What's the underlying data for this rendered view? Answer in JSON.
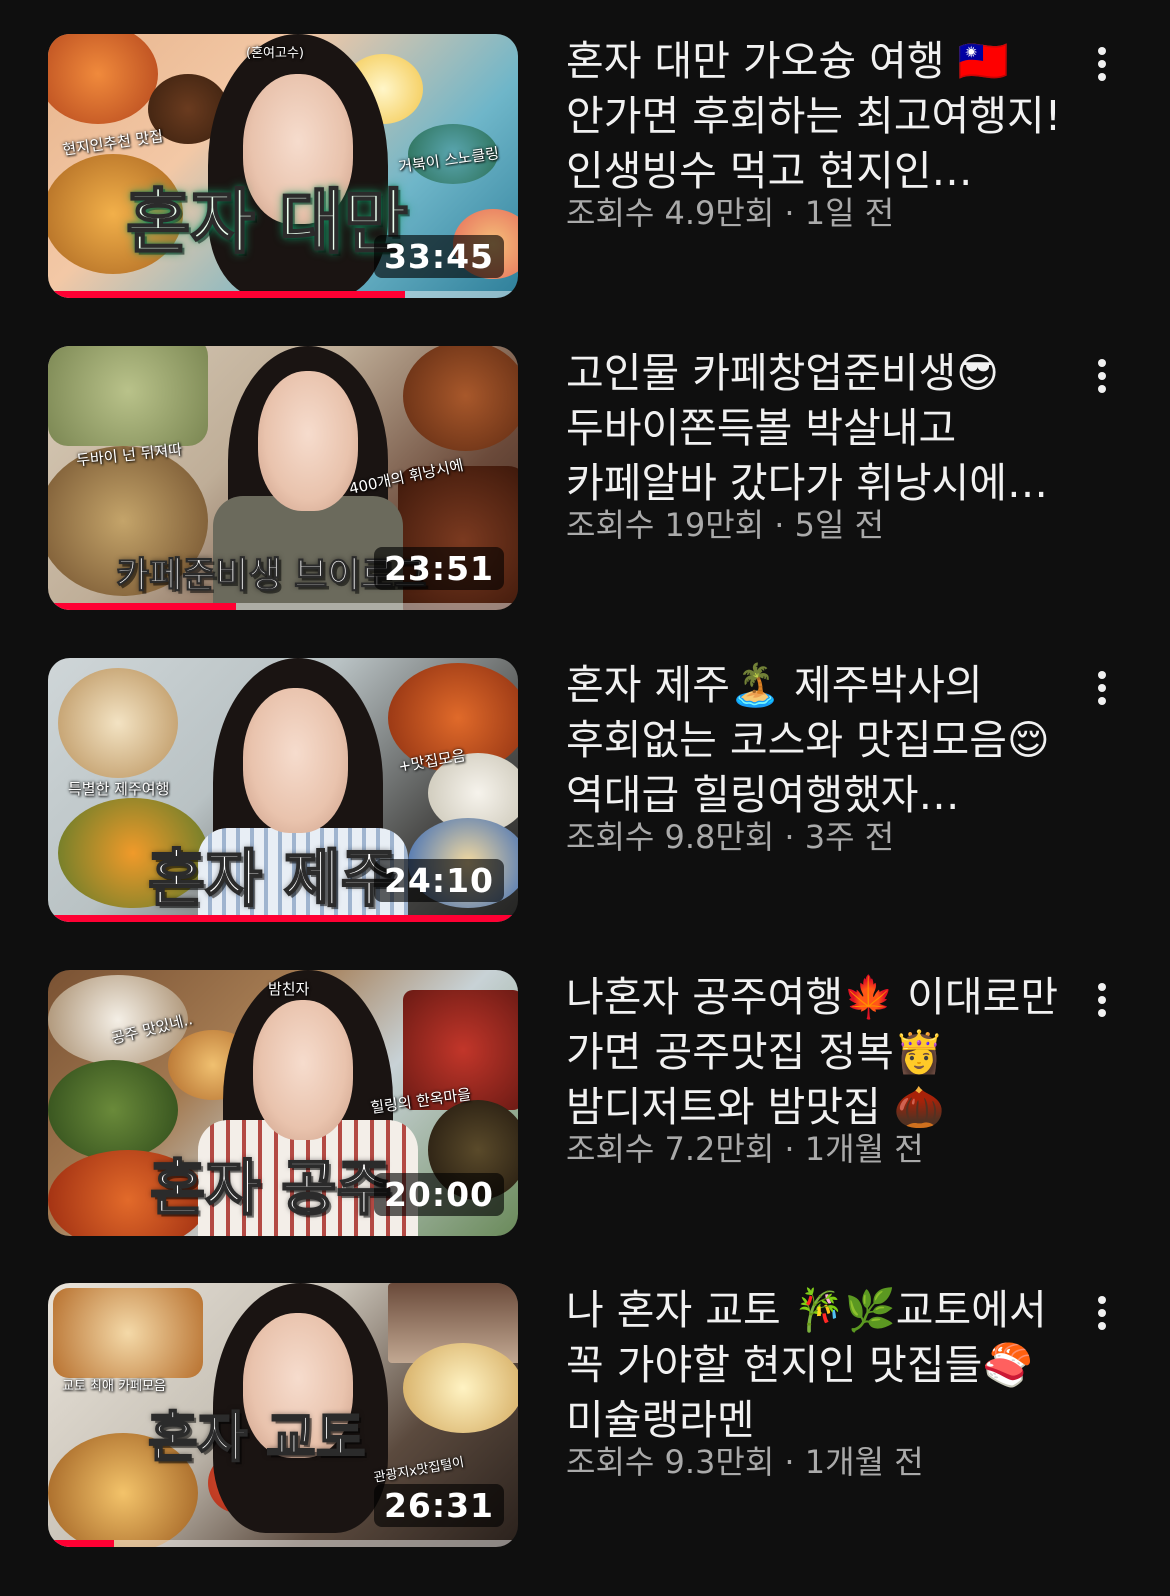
{
  "theme": {
    "background": "#0f0f0f",
    "title_color": "#f1f1f1",
    "meta_color": "#aaaaaa",
    "progress_color": "#ff0033"
  },
  "videos": [
    {
      "title": "혼자 대만 가오슝 여행 🇹🇼 안가면 후회하는 최고여행지! 인생빙수 먹고 현지인…",
      "views": "조회수 4.9만회",
      "age": "1일 전",
      "meta": "조회수 4.9만회 · 1일 전",
      "duration": "33:45",
      "watched_fraction": 0.76,
      "thumb_main_text": "혼자 대만",
      "thumb_small_texts": [
        "(혼여고수)",
        "현지인추천 맛집",
        "거북이 스노클링"
      ],
      "menu_icon": "more-vert-icon"
    },
    {
      "title": "고인물 카페창업준비생😎 두바이쫀득볼 박살내고 카페알바 갔다가 휘낭시에…",
      "views": "조회수 19만회",
      "age": "5일 전",
      "meta": "조회수 19만회 · 5일 전",
      "duration": "23:51",
      "watched_fraction": 0.4,
      "thumb_main_text": "카페준비생 브이로그",
      "thumb_small_texts": [
        "두바이 넌 뒤져따",
        "400개의 휘낭시에"
      ],
      "menu_icon": "more-vert-icon"
    },
    {
      "title": "혼자 제주🏝️ 제주박사의 후회없는 코스와 맛집모음😌 역대급 힐링여행했자…",
      "views": "조회수 9.8만회",
      "age": "3주 전",
      "meta": "조회수 9.8만회 · 3주 전",
      "duration": "24:10",
      "watched_fraction": 1.0,
      "thumb_main_text": "혼자 제주",
      "thumb_small_texts": [
        "특별한 제주여행",
        "+맛집모음"
      ],
      "menu_icon": "more-vert-icon"
    },
    {
      "title": "나혼자 공주여행🍁 이대로만 가면 공주맛집 정복👸 밤디저트와 밤맛집 🌰",
      "views": "조회수 7.2만회",
      "age": "1개월 전",
      "meta": "조회수 7.2만회 · 1개월 전",
      "duration": "20:00",
      "watched_fraction": 0.0,
      "thumb_main_text": "혼자 공주",
      "thumb_small_texts": [
        "밤친자",
        "공주 맛있네..",
        "힐링의 한옥마을"
      ],
      "menu_icon": "more-vert-icon"
    },
    {
      "title": "나 혼자 교토 🎋🌿교토에서 꼭 가야할 현지인 맛집들🍣미슐랭라멘",
      "views": "조회수 9.3만회",
      "age": "1개월 전",
      "meta": "조회수 9.3만회 · 1개월 전",
      "duration": "26:31",
      "watched_fraction": 0.14,
      "thumb_main_text": "혼자 교토",
      "thumb_small_texts": [
        "교토 최애 카페모음",
        "관광지x맛집털이"
      ],
      "menu_icon": "more-vert-icon"
    }
  ]
}
